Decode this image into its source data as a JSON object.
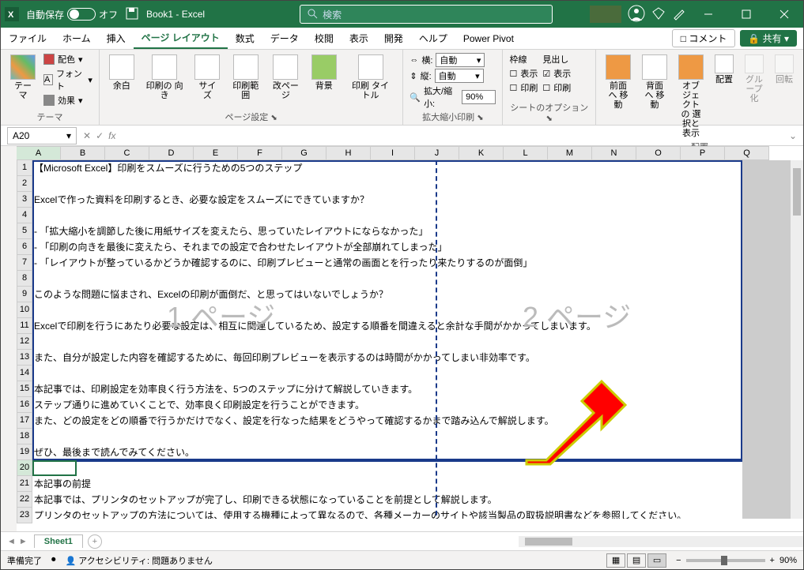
{
  "titlebar": {
    "autosave_label": "自動保存",
    "autosave_state": "オフ",
    "doc": "Book1 - Excel",
    "search_placeholder": "検索"
  },
  "tabs": {
    "file": "ファイル",
    "home": "ホーム",
    "insert": "挿入",
    "pagelayout": "ページ レイアウト",
    "formulas": "数式",
    "data": "データ",
    "review": "校閲",
    "view": "表示",
    "developer": "開発",
    "help": "ヘルプ",
    "powerpivot": "Power Pivot",
    "comment": "コメント",
    "share": "共有"
  },
  "ribbon": {
    "themes": {
      "label": "テーマ",
      "main": "テーマ",
      "colors": "配色",
      "fonts": "フォント",
      "effects": "効果"
    },
    "pagesetup": {
      "label": "ページ設定",
      "margins": "余白",
      "orientation": "印刷の\n向き",
      "size": "サイズ",
      "printarea": "印刷範囲",
      "breaks": "改ページ",
      "background": "背景",
      "printtitles": "印刷\nタイトル"
    },
    "scale": {
      "label": "拡大縮小印刷",
      "width": "横:",
      "height": "縦:",
      "auto": "自動",
      "scalelabel": "拡大/縮小:",
      "scaleval": "90%"
    },
    "sheetopt": {
      "label": "シートのオプション",
      "gridlines": "枠線",
      "headings": "見出し",
      "view": "表示",
      "print": "印刷"
    },
    "arrange": {
      "label": "配置",
      "front": "前面へ\n移動",
      "back": "背面へ\n移動",
      "selection": "オブジェクトの\n選択と表示",
      "align": "配置",
      "group": "グループ化",
      "rotate": "回転"
    }
  },
  "namebox": "A20",
  "columns": [
    "A",
    "B",
    "C",
    "D",
    "E",
    "F",
    "G",
    "H",
    "I",
    "J",
    "K",
    "L",
    "M",
    "N",
    "O",
    "P",
    "Q"
  ],
  "rows_count": 23,
  "rows": {
    "1": "【Microsoft Excel】印刷をスムーズに行うための5つのステップ",
    "3": "Excelで作った資料を印刷するとき、必要な設定をスムーズにできていますか？",
    "5": "- 「拡大縮小を調節した後に用紙サイズを変えたら、思っていたレイアウトにならなかった」",
    "6": "- 「印刷の向きを最後に変えたら、それまでの設定で合わせたレイアウトが全部崩れてしまった」",
    "7": "- 「レイアウトが整っているかどうか確認するのに、印刷プレビューと通常の画面とを行ったり来たりするのが面倒」",
    "9": "このような問題に悩まされ、Excelの印刷が面倒だ、と思ってはいないでしょうか？",
    "11": "Excelで印刷を行うにあたり必要な設定は、相互に関連しているため、設定する順番を間違えると余計な手間がかかってしまいます。",
    "13": "また、自分が設定した内容を確認するために、毎回印刷プレビューを表示するのは時間がかかってしまい非効率です。",
    "15": "本記事では、印刷設定を効率良く行う方法を、5つのステップに分けて解説していきます。",
    "16": "ステップ通りに進めていくことで、効率良く印刷設定を行うことができます。",
    "17": "また、どの設定をどの順番で行うかだけでなく、設定を行なった結果をどうやって確認するかまで踏み込んで解説します。",
    "19": "ぜひ、最後まで読んでみてください。",
    "21": "本記事の前提",
    "22": "本記事では、プリンタのセットアップが完了し、印刷できる状態になっていることを前提として解説します。",
    "23": "プリンタのセットアップの方法については、使用する機種によって異なるので、各種メーカーのサイトや該当製品の取扱説明書などを参照してください。"
  },
  "watermarks": {
    "p1": "1 ページ",
    "p2": "2 ページ"
  },
  "sheettab": "Sheet1",
  "status": {
    "ready": "準備完了",
    "access": "アクセシビリティ: 問題ありません",
    "zoom": "90%"
  }
}
